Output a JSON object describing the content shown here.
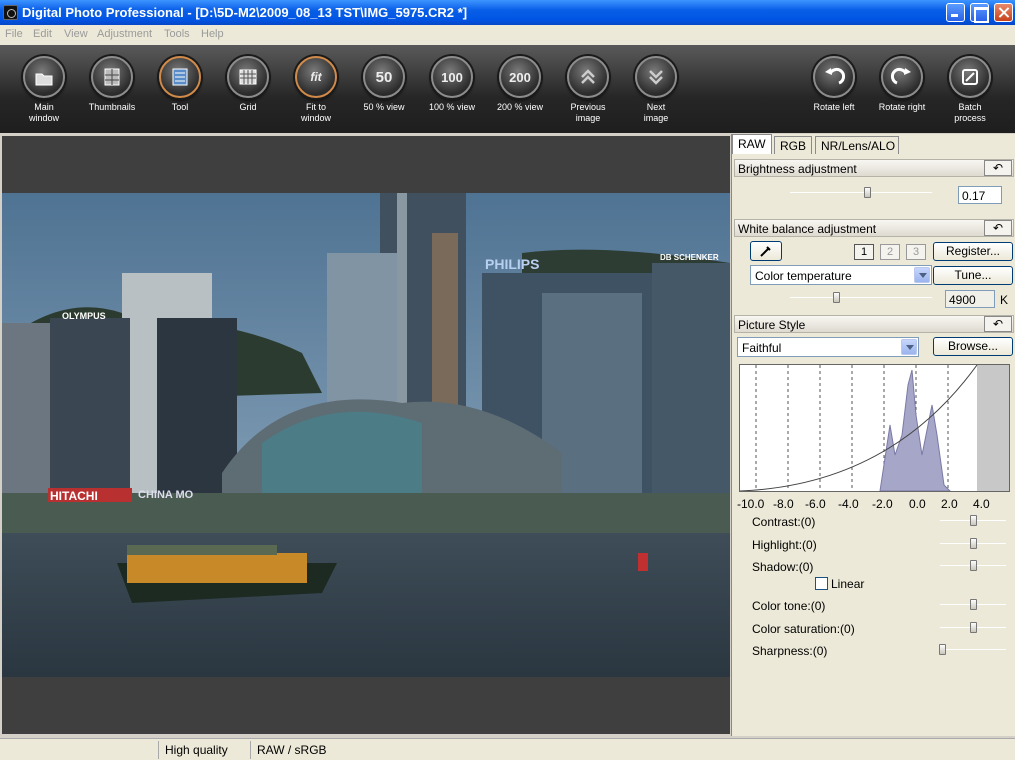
{
  "window": {
    "title": "Digital Photo Professional - [D:\\5D-M2\\2009_08_13 TST\\IMG_5975.CR2 *]"
  },
  "menu": [
    "File",
    "Edit",
    "View",
    "Adjustment",
    "Tools",
    "Help"
  ],
  "toolbar": {
    "main_window": {
      "l1": "Main",
      "l2": "window"
    },
    "thumbnails": {
      "l1": "Thumbnails",
      "l2": ""
    },
    "tool": {
      "l1": "Tool",
      "l2": ""
    },
    "grid": {
      "l1": "Grid",
      "l2": ""
    },
    "fit": {
      "l1": "Fit to",
      "l2": "window",
      "glyph": "fit"
    },
    "v50": {
      "l1": "50 % view",
      "l2": "",
      "glyph": "50"
    },
    "v100": {
      "l1": "100 % view",
      "l2": "",
      "glyph": "100"
    },
    "v200": {
      "l1": "200 % view",
      "l2": "",
      "glyph": "200"
    },
    "prev": {
      "l1": "Previous",
      "l2": "image"
    },
    "next": {
      "l1": "Next",
      "l2": "image"
    },
    "rot_left": {
      "l1": "Rotate left",
      "l2": ""
    },
    "rot_right": {
      "l1": "Rotate right",
      "l2": ""
    },
    "batch": {
      "l1": "Batch",
      "l2": "process"
    }
  },
  "photo_signs": {
    "olympus": "OLYMPUS",
    "philips": "PHILIPS",
    "schenker": "DB SCHENKER",
    "hitachi": "HITACHI",
    "china": "CHINA MO"
  },
  "panel": {
    "tabs": [
      "RAW",
      "RGB",
      "NR/Lens/ALO"
    ],
    "brightness": {
      "header": "Brightness adjustment",
      "value": "0.17",
      "undo": "↶"
    },
    "white_balance": {
      "header": "White balance adjustment",
      "register": "Register...",
      "tune": "Tune...",
      "mode": "Color temperature",
      "kelvin": "4900",
      "unit": "K",
      "slots": [
        "1",
        "2",
        "3"
      ]
    },
    "picture_style": {
      "header": "Picture Style",
      "style": "Faithful",
      "browse": "Browse..."
    },
    "histogram_axis": [
      "-10.0",
      "-8.0",
      "-6.0",
      "-4.0",
      "-2.0",
      "0.0",
      "2.0",
      "4.0"
    ],
    "adjustments": {
      "contrast": "Contrast:(0)",
      "highlight": "Highlight:(0)",
      "shadow": "Shadow:(0)",
      "linear": "Linear",
      "color_tone": "Color tone:(0)",
      "color_saturation": "Color saturation:(0)",
      "sharpness": "Sharpness:(0)"
    }
  },
  "status": {
    "quality": "High quality",
    "mode": "RAW / sRGB"
  }
}
